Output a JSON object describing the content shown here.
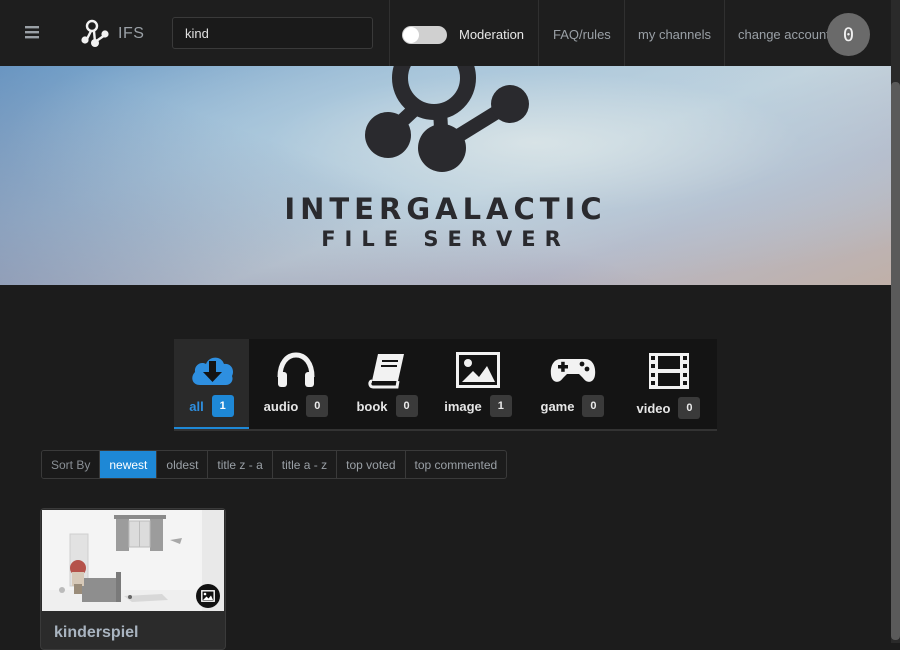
{
  "navbar": {
    "brand": "IFS",
    "search_value": "kind",
    "moderation_label": "Moderation",
    "faq_label": "FAQ/rules",
    "channels_label": "my channels",
    "account_label": "change account",
    "counter": "0"
  },
  "banner": {
    "title": "INTERGALACTIC",
    "subtitle": "FILE SERVER"
  },
  "categories": [
    {
      "label": "all",
      "count": "1",
      "icon": "cloud-download-icon"
    },
    {
      "label": "audio",
      "count": "0",
      "icon": "headphones-icon"
    },
    {
      "label": "book",
      "count": "0",
      "icon": "book-icon"
    },
    {
      "label": "image",
      "count": "1",
      "icon": "image-icon"
    },
    {
      "label": "game",
      "count": "0",
      "icon": "gamepad-icon"
    },
    {
      "label": "video",
      "count": "0",
      "icon": "film-icon"
    }
  ],
  "sort": {
    "label": "Sort By",
    "options": [
      "newest",
      "oldest",
      "title z - a",
      "title a - z",
      "top voted",
      "top commented"
    ],
    "selected": "newest"
  },
  "results": [
    {
      "title": "kinderspiel",
      "type_icon": "image-icon"
    }
  ],
  "colors": {
    "accent": "#1e88d6",
    "background": "#1c1c1c"
  }
}
